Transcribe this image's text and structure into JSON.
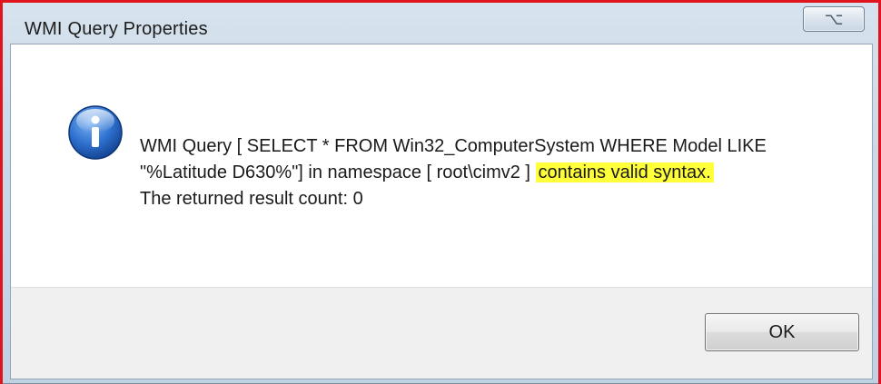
{
  "window": {
    "title": "WMI Query Properties",
    "close_glyph": "⌥"
  },
  "message": {
    "icon": "info-icon",
    "line1_prefix": "WMI Query [ SELECT * FROM Win32_ComputerSystem WHERE Model LIKE \"%Latitude D630%\"]  in namespace [ root\\cimv2 ] ",
    "highlighted": "contains valid syntax.",
    "line2": "The returned result count: 0"
  },
  "buttons": {
    "ok_label": "OK"
  },
  "colors": {
    "highlight": "#ffff3a",
    "annotation_frame": "#e0141c",
    "icon_blue": "#1f5fbf"
  }
}
